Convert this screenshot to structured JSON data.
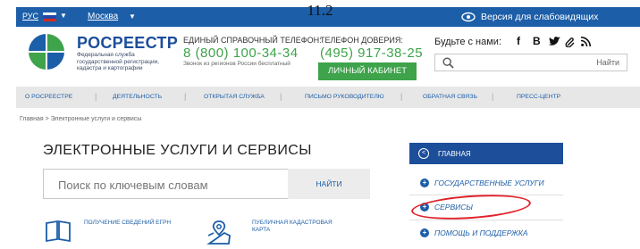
{
  "figure_number": "11.2",
  "topbar": {
    "lang": "РУС",
    "city": "Москва",
    "low_vision": "Версия для слабовидящих"
  },
  "header": {
    "brand": "РОСРЕЕСТР",
    "brand_sub": "Федеральная служба государственной регистрации, кадастра и картографии",
    "phone_label": "ЕДИНЫЙ СПРАВОЧНЫЙ ТЕЛЕФОН:",
    "phone_number": "8 (800) 100-34-34",
    "phone_note": "Звонок из регионов России бесплатный",
    "trust_label": "ТЕЛЕФОН ДОВЕРИЯ:",
    "trust_number": "(495) 917-38-25",
    "cabinet_button": "ЛИЧНЫЙ КАБИНЕТ",
    "social_label": "Будьте с нами:",
    "search_button": "Найти"
  },
  "nav": [
    "О РОСРЕЕСТРЕ",
    "ДЕЯТЕЛЬНОСТЬ",
    "ОТКРЫТАЯ СЛУЖБА",
    "ПИСЬМО РУКОВОДИТЕЛЮ",
    "ОБРАТНАЯ СВЯЗЬ",
    "ПРЕСС-ЦЕНТР"
  ],
  "breadcrumb": "Главная  >  Электронные услуги и сервисы",
  "main": {
    "title": "ЭЛЕКТРОННЫЕ УСЛУГИ И СЕРВИСЫ",
    "search_placeholder": "Поиск по ключевым словам",
    "find_button": "НАЙТИ",
    "services": [
      {
        "label": "ПОЛУЧЕНИЕ СВЕДЕНИЙ ЕГРН",
        "icon": "book-icon"
      },
      {
        "label": "ПУБЛИЧНАЯ КАДАСТРОВАЯ КАРТА",
        "icon": "map-icon"
      }
    ]
  },
  "sidebar": {
    "home": "ГЛАВНАЯ",
    "items": [
      "ГОСУДАРСТВЕННЫЕ УСЛУГИ",
      "СЕРВИСЫ",
      "ПОМОЩЬ И ПОДДЕРЖКА"
    ],
    "highlighted": "СЕРВИСЫ"
  },
  "colors": {
    "brand_blue": "#1c5ea8",
    "green": "#3ea34a",
    "highlight_red": "#e0232b"
  }
}
